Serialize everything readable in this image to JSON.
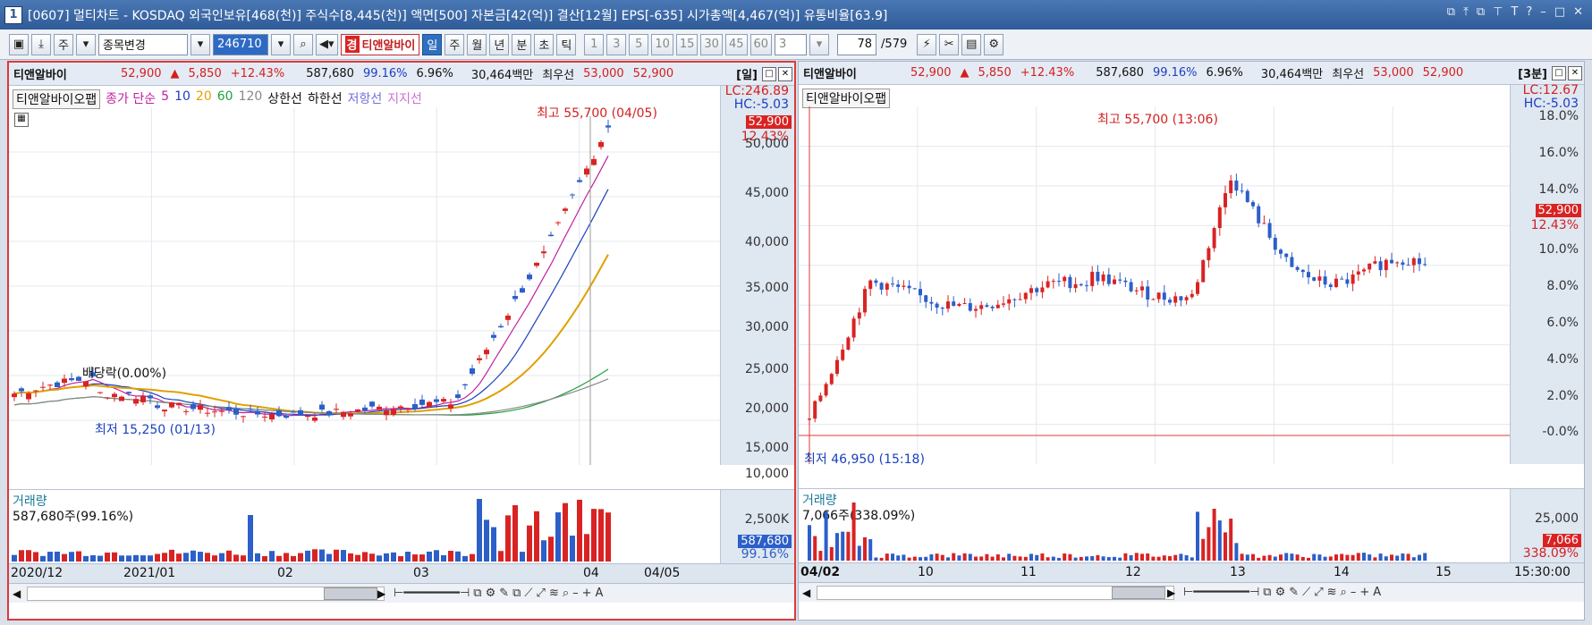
{
  "window": {
    "number": "1",
    "title": "[0607] 멀티차트 - KOSDAQ 외국인보유[468(천)] 주식수[8,445(천)] 액면[500] 자본금[42(억)] 결산[12월] EPS[-635] 시가총액[4,467(억)] 유통비율[63.9]",
    "buttons": [
      "⧉",
      "⤒",
      "⧉",
      "⊤",
      "T",
      "?",
      "–",
      "□",
      "✕"
    ]
  },
  "toolbar": {
    "market": "주",
    "change_label": "종목변경",
    "code": "246710",
    "stock_prefix": "경",
    "stock_name": "티앤알바이",
    "periods": [
      "일",
      "주",
      "월",
      "년",
      "분",
      "초",
      "틱"
    ],
    "selected_period": "일",
    "numbers": [
      "1",
      "3",
      "5",
      "10",
      "15",
      "30",
      "45",
      "60"
    ],
    "combo_value": "3",
    "page": "78",
    "total": "/579"
  },
  "left": {
    "header": {
      "name": "티앤알바이",
      "price": "52,900",
      "arrow": "▲",
      "change": "5,850",
      "rate": "+12.43%",
      "volume": "587,680",
      "vol_rate": "99.16%",
      "turnover": "6.96%",
      "amount": "30,464백만",
      "bid_label": "최우선",
      "bid": "53,000",
      "ask": "52,900",
      "period": "[일]"
    },
    "legend": {
      "tag": "티앤알바이오팹",
      "ma_label": "종가 단순",
      "ma": [
        "5",
        "10",
        "20",
        "60",
        "120"
      ],
      "upper": "상한선",
      "lower": "하한선",
      "resist": "저항선",
      "support": "지지선"
    },
    "annotations": {
      "high": "최고 55,700 (04/05)",
      "low": "최저 15,250 (01/13)",
      "dividend": "배당락(0.00%)"
    },
    "axis_labels": [
      "50,000",
      "45,000",
      "40,000",
      "35,000",
      "30,000",
      "25,000",
      "20,000",
      "15,000",
      "10,000"
    ],
    "lc": "LC:246.89",
    "hc": "HC:-5.03",
    "price_badge": "52,900",
    "rate_badge": "12.43%",
    "volume_panel": {
      "title": "거래량",
      "value": "587,680주(99.16%)",
      "axis": "2,500K",
      "badge": "587,680",
      "badge_rate": "99.16%"
    },
    "dates": [
      "2020/12",
      "2021/01",
      "02",
      "03",
      "04",
      "04/05"
    ]
  },
  "right": {
    "header": {
      "name": "티앤알바이",
      "price": "52,900",
      "arrow": "▲",
      "change": "5,850",
      "rate": "+12.43%",
      "volume": "587,680",
      "vol_rate": "99.16%",
      "turnover": "6.96%",
      "amount": "30,464백만",
      "bid_label": "최우선",
      "bid": "53,000",
      "ask": "52,900",
      "period": "[3분]"
    },
    "legend": {
      "tag": "티앤알바이오팹"
    },
    "annotations": {
      "high": "최고 55,700 (13:06)",
      "low": "최저 46,950 (15:18)"
    },
    "axis_labels": [
      "18.0%",
      "16.0%",
      "14.0%",
      "12.0%",
      "10.0%",
      "8.0%",
      "6.0%",
      "4.0%",
      "2.0%",
      "-0.0%"
    ],
    "lc": "LC:12.67",
    "hc": "HC:-5.03",
    "price_badge": "52,900",
    "rate_badge": "12.43%",
    "volume_panel": {
      "title": "거래량",
      "value": "7,066주(338.09%)",
      "axis": "25,000",
      "badge": "7,066",
      "badge_rate": "338.09%"
    },
    "dates": [
      "04/02",
      "10",
      "11",
      "12",
      "13",
      "14",
      "15",
      "15:30:00"
    ]
  },
  "colors": {
    "up": "#d92323",
    "down": "#2c5fc8",
    "accent": "#2f5b98"
  }
}
